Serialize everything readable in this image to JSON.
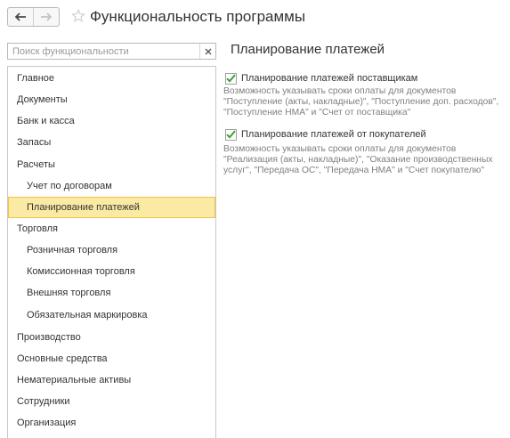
{
  "header": {
    "title": "Функциональность программы",
    "back_icon": "arrow-left-icon",
    "forward_icon": "arrow-right-icon",
    "favorite_icon": "star-icon"
  },
  "search": {
    "placeholder": "Поиск функциональности",
    "value": "",
    "clear_icon": "close-icon"
  },
  "sidebar": {
    "items": [
      {
        "label": "Главное",
        "level": 0
      },
      {
        "label": "Документы",
        "level": 0
      },
      {
        "label": "Банк и касса",
        "level": 0
      },
      {
        "label": "Запасы",
        "level": 0
      },
      {
        "label": "Расчеты",
        "level": 0
      },
      {
        "label": "Учет по договорам",
        "level": 1
      },
      {
        "label": "Планирование платежей",
        "level": 1,
        "selected": true
      },
      {
        "label": "Торговля",
        "level": 0
      },
      {
        "label": "Розничная торговля",
        "level": 1
      },
      {
        "label": "Комиссионная торговля",
        "level": 1
      },
      {
        "label": "Внешняя торговля",
        "level": 1
      },
      {
        "label": "Обязательная маркировка",
        "level": 1
      },
      {
        "label": "Производство",
        "level": 0
      },
      {
        "label": "Основные средства",
        "level": 0
      },
      {
        "label": "Нематериальные активы",
        "level": 0
      },
      {
        "label": "Сотрудники",
        "level": 0
      },
      {
        "label": "Организация",
        "level": 0
      }
    ],
    "selected_color": "#fbeaa3"
  },
  "main": {
    "section_title": "Планирование платежей",
    "options": [
      {
        "label": "Планирование платежей поставщикам",
        "checked": true,
        "description": "Возможность указывать сроки оплаты для документов \"Поступление (акты, накладные)\", \"Поступление доп. расходов\", \"Поступление НМА\" и \"Счет от поставщика\""
      },
      {
        "label": "Планирование платежей от покупателей",
        "checked": true,
        "description": "Возможность указывать сроки оплаты для документов \"Реализация (акты, накладные)\", \"Оказание производственных услуг\", \"Передача ОС\", \"Передача НМА\" и \"Счет покупателю\""
      }
    ],
    "check_color": "#3fa037"
  }
}
